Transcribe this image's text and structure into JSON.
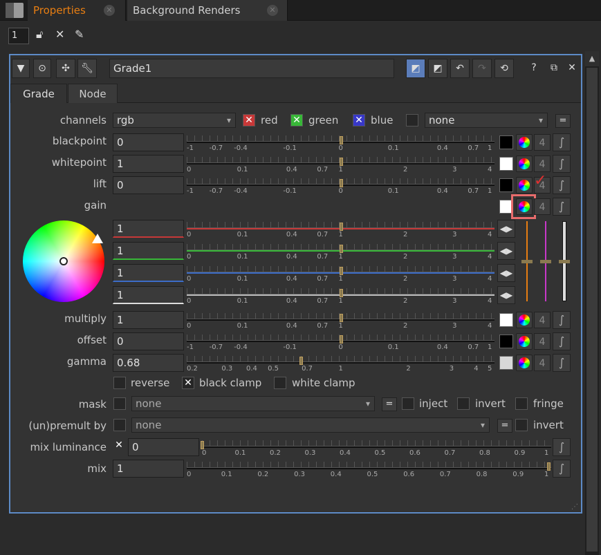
{
  "tabs": {
    "properties": "Properties",
    "background_renders": "Background Renders",
    "close": "✕"
  },
  "toolbar": {
    "max_panels": "1"
  },
  "node": {
    "name": "Grade1",
    "help": "?",
    "float": "⧉",
    "close": "✕",
    "tabs": [
      "Grade",
      "Node"
    ]
  },
  "channels": {
    "label": "channels",
    "value": "rgb",
    "red": "red",
    "green": "green",
    "blue": "blue",
    "extra": "none",
    "eq": "="
  },
  "knobs": {
    "blackpoint": {
      "label": "blackpoint",
      "value": "0"
    },
    "whitepoint": {
      "label": "whitepoint",
      "value": "1"
    },
    "lift": {
      "label": "lift",
      "value": "0"
    },
    "gain": {
      "label": "gain",
      "values": [
        "1",
        "1",
        "1",
        "1"
      ]
    },
    "multiply": {
      "label": "multiply",
      "value": "1"
    },
    "offset": {
      "label": "offset",
      "value": "0"
    },
    "gamma": {
      "label": "gamma",
      "value": "0.68"
    }
  },
  "scales": {
    "signed": [
      "-1",
      "-0.7",
      "-0.4",
      "-0.1",
      "0",
      "0.1",
      "0.4",
      "0.7",
      "1"
    ],
    "positive": [
      "0",
      "0.1",
      "0.4",
      "0.7",
      "1",
      "2",
      "3",
      "4"
    ],
    "gamma": [
      "0.2",
      "0.3",
      "0.4",
      "0.5",
      "0.7",
      "1",
      "2",
      "3",
      "4",
      "5"
    ],
    "mix": [
      "0",
      "0.1",
      "0.2",
      "0.3",
      "0.4",
      "0.5",
      "0.6",
      "0.7",
      "0.8",
      "0.9",
      "1"
    ]
  },
  "four": "4",
  "options": {
    "reverse": "reverse",
    "black_clamp": "black clamp",
    "white_clamp": "white clamp"
  },
  "mask": {
    "label": "mask",
    "value": "none",
    "eq": "=",
    "inject": "inject",
    "invert": "invert",
    "fringe": "fringe"
  },
  "premult": {
    "label": "(un)premult by",
    "value": "none",
    "eq": "=",
    "invert": "invert"
  },
  "mix_luminance": {
    "label": "mix luminance",
    "value": "0"
  },
  "mix": {
    "label": "mix",
    "value": "1"
  },
  "accent": "#e87e12",
  "highlight": "#e86c6c"
}
